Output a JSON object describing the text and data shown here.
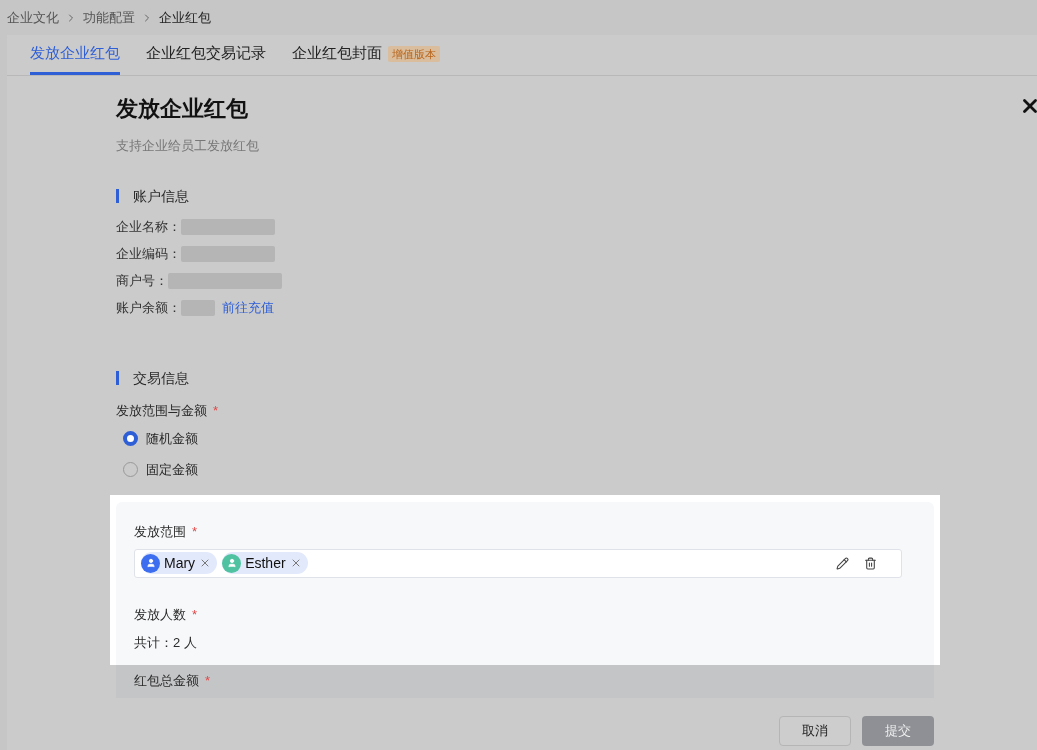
{
  "breadcrumb": [
    "企业文化",
    "功能配置",
    "企业红包"
  ],
  "tabs": [
    {
      "label": "发放企业红包",
      "selected": true
    },
    {
      "label": "企业红包交易记录",
      "selected": false
    },
    {
      "label": "企业红包封面",
      "selected": false,
      "badge": "增值版本"
    }
  ],
  "title": "发放企业红包",
  "subtitle": "支持企业给员工发放红包",
  "account": {
    "heading": "账户信息",
    "fields": [
      {
        "label": "企业名称："
      },
      {
        "label": "企业编码："
      },
      {
        "label": "商户号："
      },
      {
        "label": "账户余额：",
        "link": "前往充值"
      }
    ]
  },
  "trade": {
    "heading": "交易信息",
    "amount_label": "发放范围与金额",
    "required_mark": "*",
    "options": [
      {
        "label": "随机金额",
        "selected": true
      },
      {
        "label": "固定金额",
        "selected": false
      }
    ]
  },
  "scope": {
    "label": "发放范围",
    "required_mark": "*",
    "recipients": [
      {
        "name": "Mary",
        "color": "#3d6ef0"
      },
      {
        "name": "Esther",
        "color": "#4fc3a1"
      }
    ]
  },
  "count": {
    "label": "发放人数",
    "required_mark": "*",
    "text": "共计：2 人"
  },
  "total": {
    "label": "红包总金额",
    "required_mark": "*"
  },
  "buttons": [
    {
      "label": "取消",
      "disabled": false
    },
    {
      "label": "提交",
      "disabled": true
    }
  ]
}
